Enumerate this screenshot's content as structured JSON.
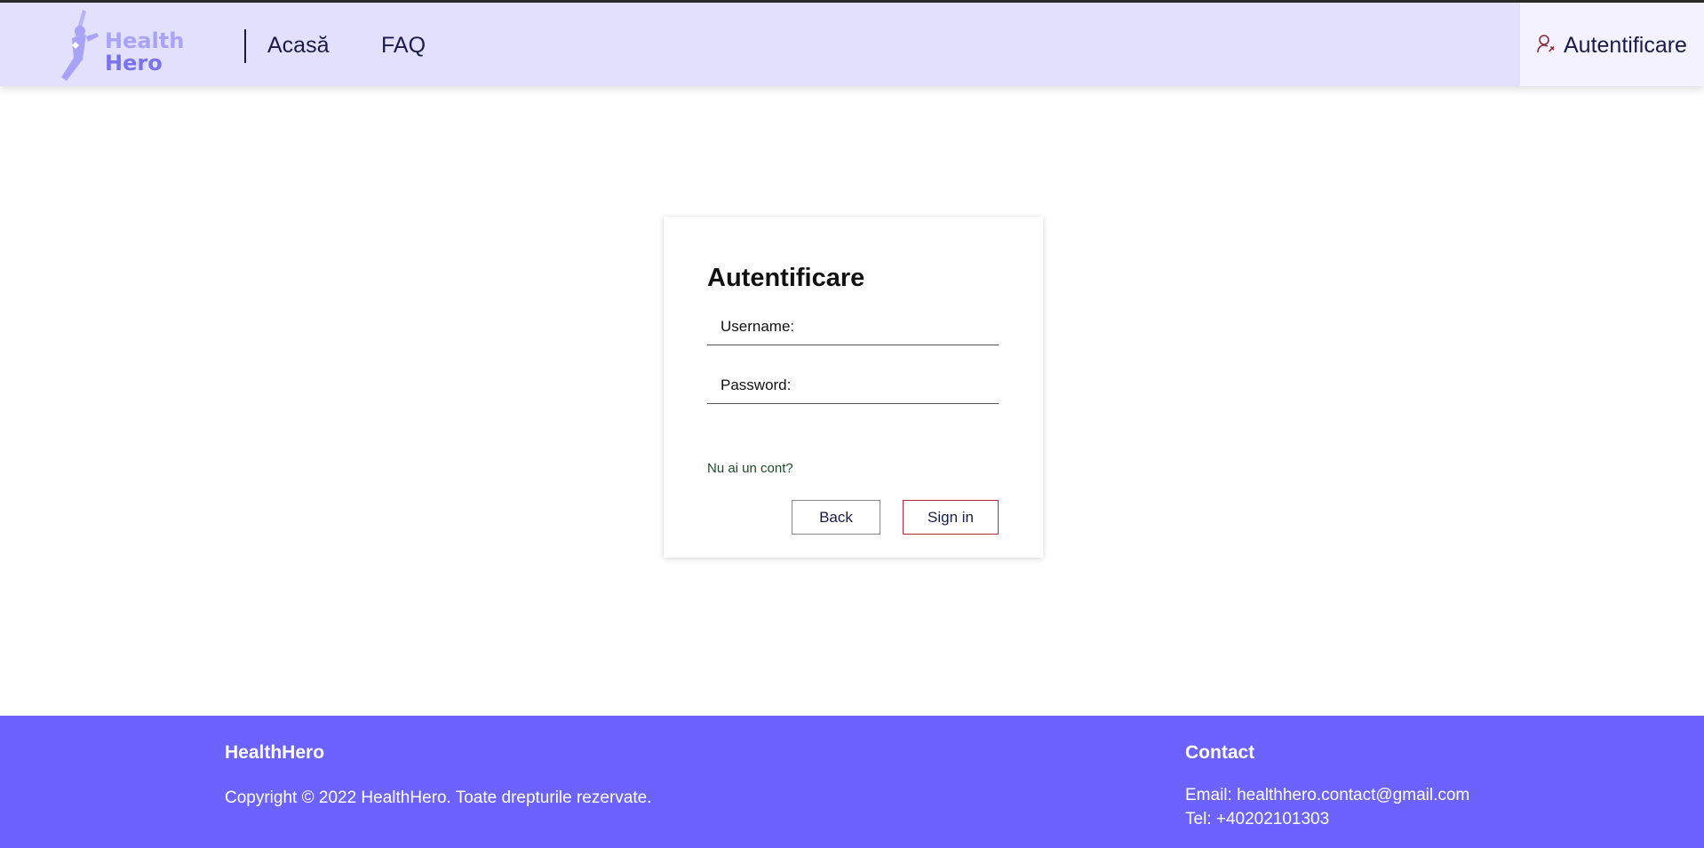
{
  "brand": {
    "logo_line1": "Health",
    "logo_line2": "Hero"
  },
  "nav": {
    "items": [
      {
        "label": "Acasă"
      },
      {
        "label": "FAQ"
      }
    ],
    "auth_label": "Autentificare"
  },
  "login": {
    "title": "Autentificare",
    "username_label": "Username:",
    "username_value": "",
    "password_label": "Password:",
    "password_value": "",
    "no_account_link": "Nu ai un cont?",
    "back_button": "Back",
    "signin_button": "Sign in"
  },
  "footer": {
    "brand": "HealthHero",
    "copyright": "Copyright © 2022 HealthHero. Toate drepturile rezervate.",
    "contact_title": "Contact",
    "email": "Email: healthhero.contact@gmail.com",
    "tel": "Tel: +40202101303"
  },
  "colors": {
    "navbar_bg": "#e2e0fd",
    "footer_bg": "#6c63ff",
    "accent_red": "#b02a3a"
  }
}
